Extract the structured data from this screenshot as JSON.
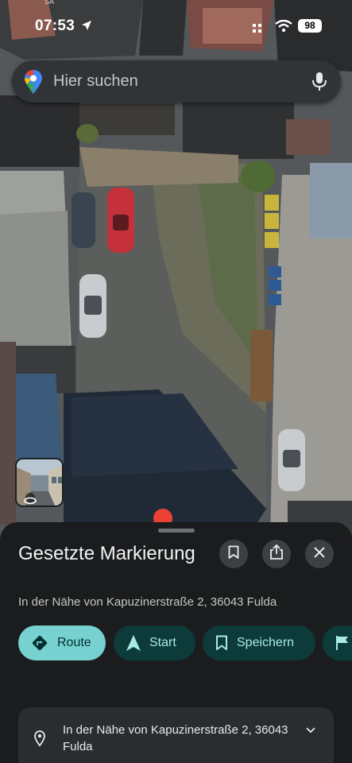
{
  "status_bar": {
    "time": "07:53",
    "carrier_hint": "SA",
    "battery": "98"
  },
  "search": {
    "placeholder": "Hier suchen"
  },
  "sheet": {
    "title": "Gesetzte Markierung",
    "subtitle": "In der Nähe von Kapuzinerstraße 2, 36043 Fulda",
    "actions": [
      {
        "label": "Route",
        "icon": "directions-icon"
      },
      {
        "label": "Start",
        "icon": "navigation-arrow-icon"
      },
      {
        "label": "Speichern",
        "icon": "bookmark-icon"
      },
      {
        "label": "",
        "icon": "flag-icon"
      }
    ],
    "address_card": {
      "text": "In der Nähe von Kapuzinerstraße 2, 36043 Fulda"
    }
  },
  "colors": {
    "accent": "#76d1d0",
    "chip_bg": "#0d3b3a",
    "sheet_bg": "#1b1c1e",
    "marker": "#ea4335"
  }
}
